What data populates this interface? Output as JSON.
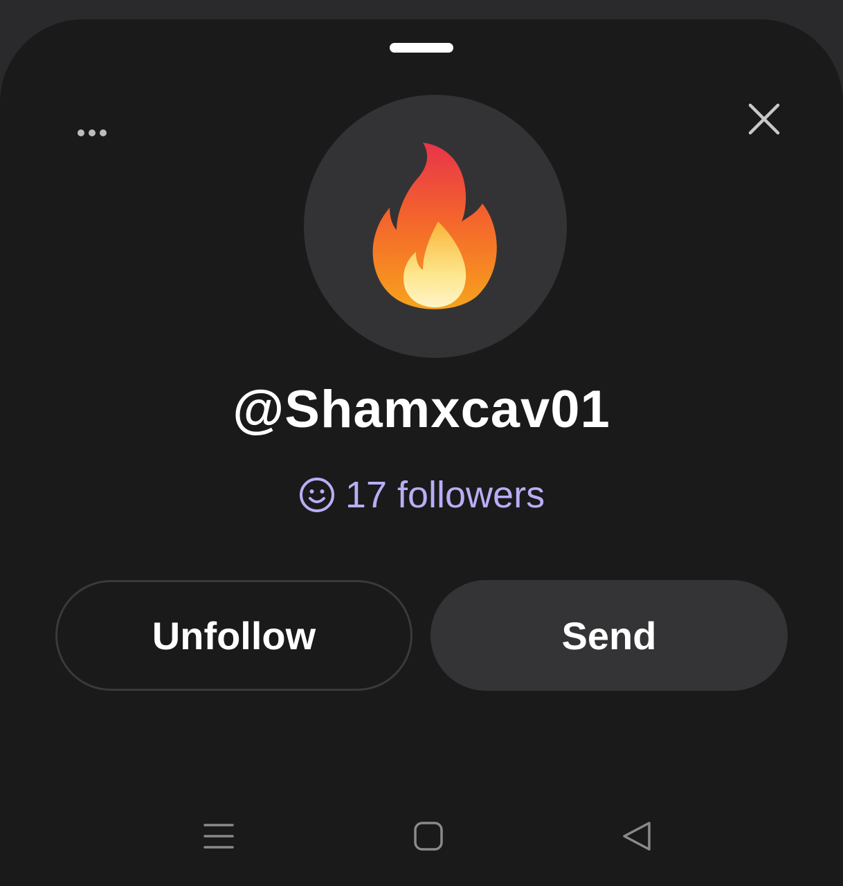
{
  "profile": {
    "username": "@Shamxcav01",
    "followers_text": "17 followers",
    "avatar_emoji": "fire-icon"
  },
  "actions": {
    "unfollow_label": "Unfollow",
    "send_label": "Send"
  },
  "header": {
    "more_icon": "more-horizontal-icon",
    "close_icon": "close-icon"
  },
  "nav": {
    "items": [
      "recent-apps-icon",
      "home-icon",
      "back-icon"
    ]
  },
  "colors": {
    "sheet_background": "#1a1a1b",
    "avatar_background": "#333335",
    "followers_accent": "#b9aef5",
    "send_button_background": "#343436"
  }
}
